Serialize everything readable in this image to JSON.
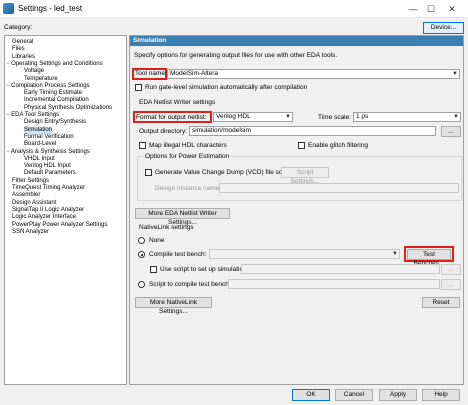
{
  "window": {
    "title": "Settings - led_test",
    "icons": [
      "quartus-app-icon",
      "minimize-icon",
      "maximize-icon",
      "close-icon"
    ]
  },
  "category_label": "Category:",
  "device_button": "Device...",
  "tree": {
    "items": [
      {
        "label": "General",
        "level": 0
      },
      {
        "label": "Files",
        "level": 0
      },
      {
        "label": "Libraries",
        "level": 0
      },
      {
        "label": "Operating Settings and Conditions",
        "level": 0,
        "expander": "minus"
      },
      {
        "label": "Voltage",
        "level": 1
      },
      {
        "label": "Temperature",
        "level": 1
      },
      {
        "label": "Compilation Process Settings",
        "level": 0,
        "expander": "minus"
      },
      {
        "label": "Early Timing Estimate",
        "level": 1
      },
      {
        "label": "Incremental Compilation",
        "level": 1
      },
      {
        "label": "Physical Synthesis Optimizations",
        "level": 1
      },
      {
        "label": "EDA Tool Settings",
        "level": 0,
        "expander": "minus"
      },
      {
        "label": "Design Entry/Synthesis",
        "level": 1
      },
      {
        "label": "Simulation",
        "level": 1,
        "selected": true
      },
      {
        "label": "Formal Verification",
        "level": 1
      },
      {
        "label": "Board-Level",
        "level": 1
      },
      {
        "label": "Analysis & Synthesis Settings",
        "level": 0,
        "expander": "minus"
      },
      {
        "label": "VHDL Input",
        "level": 1
      },
      {
        "label": "Verilog HDL Input",
        "level": 1
      },
      {
        "label": "Default Parameters",
        "level": 1
      },
      {
        "label": "Fitter Settings",
        "level": 0
      },
      {
        "label": "TimeQuest Timing Analyzer",
        "level": 0
      },
      {
        "label": "Assembler",
        "level": 0
      },
      {
        "label": "Design Assistant",
        "level": 0
      },
      {
        "label": "SignalTap II Logic Analyzer",
        "level": 0
      },
      {
        "label": "Logic Analyzer Interface",
        "level": 0
      },
      {
        "label": "PowerPlay Power Analyzer Settings",
        "level": 0
      },
      {
        "label": "SSN Analyzer",
        "level": 0
      }
    ]
  },
  "panel": {
    "header": "Simulation",
    "description": "Specify options for generating output files for use with other EDA tools.",
    "tool_name_label": "Tool name:",
    "tool_name_value": "ModelSim-Altera",
    "run_gate_level": "Run gate-level simulation automatically after compilation",
    "eda_netlist_title": "EDA Netlist Writer settings",
    "format_label": "Format for output netlist:",
    "format_value": "Verilog HDL",
    "time_scale_label": "Time scale:",
    "time_scale_value": "1 ps",
    "output_dir_label": "Output directory:",
    "output_dir_value": "simulation/modelsim",
    "browse": "...",
    "map_illegal": "Map illegal HDL characters",
    "enable_glitch": "Enable glitch filtering",
    "power_options_title": "Options for Power Estimation",
    "generate_vcd": "Generate Value Change Dump (VCD) file script",
    "script_settings": "Script Settings...",
    "design_instance_label": "Design instance name:",
    "more_eda_button": "More EDA Netlist Writer Settings...",
    "nativelink_title": "NativeLink settings",
    "none_label": "None",
    "compile_tb_label": "Compile test bench:",
    "test_benches_button": "Test Benches...",
    "use_script_label": "Use script to set up simulation:",
    "script_compile_label": "Script to compile test bench:",
    "more_nativelink_button": "More NativeLink Settings...",
    "reset_button": "Reset"
  },
  "footer": {
    "ok": "OK",
    "cancel": "Cancel",
    "apply": "Apply",
    "help": "Help"
  },
  "highlight_color": "#e0201a"
}
